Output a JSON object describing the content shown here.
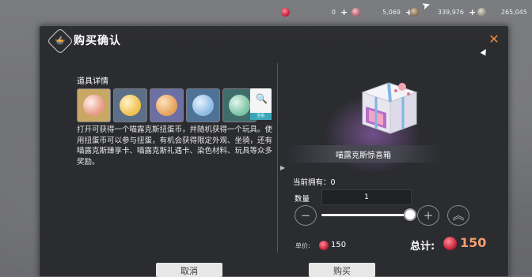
{
  "currencies": [
    {
      "name": "red-gem",
      "value": "0",
      "plus": "+",
      "color": "#c2182e"
    },
    {
      "name": "pink-gem",
      "value": "5,069",
      "plus": "+",
      "color": "#b05c6a"
    },
    {
      "name": "brown-coin",
      "value": "339,976",
      "plus": "+",
      "color": "#7c6a4f"
    },
    {
      "name": "grey-coin",
      "value": "265,045",
      "plus": "+",
      "color": "#8a8678"
    }
  ],
  "dialog": {
    "title": "购买确认",
    "title_icon": "bowl-icon",
    "close_icon": "close-icon"
  },
  "item_details": {
    "label": "道具详情",
    "items": [
      {
        "name": "egg-coin-1",
        "color": "#e79a84"
      },
      {
        "name": "egg-coin-2",
        "color": "#f1c14f"
      },
      {
        "name": "egg-coin-3",
        "color": "#e6a25a"
      },
      {
        "name": "egg-coin-4",
        "color": "#8ebbe4"
      },
      {
        "name": "egg-coin-5",
        "color": "#7cc3a4"
      }
    ],
    "view_tag": "查看",
    "description": "打开可获得一个喵露克斯扭蛋币，并随机获得一个玩具。使用扭蛋币可以参与扭蛋，有机会获得限定外观、坐骑，还有喵露克斯臻享卡、喵露克斯礼遇卡、染色材料、玩具等众多奖励。"
  },
  "product": {
    "name": "喵露克斯惊喜箱",
    "owned_label": "当前拥有：",
    "owned_value": "0",
    "quantity_label": "数量",
    "quantity_value": "1",
    "quantity_fraction": 1.0,
    "minus_label": "−",
    "plus_label": "+",
    "max_label": "︽",
    "unit_price_label": "单价:",
    "unit_price_value": "150",
    "total_label": "总计:",
    "total_value": "150"
  },
  "footer": {
    "cancel_label": "取消",
    "buy_label": "购买"
  },
  "colors": {
    "accent": "#f08b3d",
    "total_value": "#f2a071",
    "dialog_bg": "#2b2c30"
  }
}
